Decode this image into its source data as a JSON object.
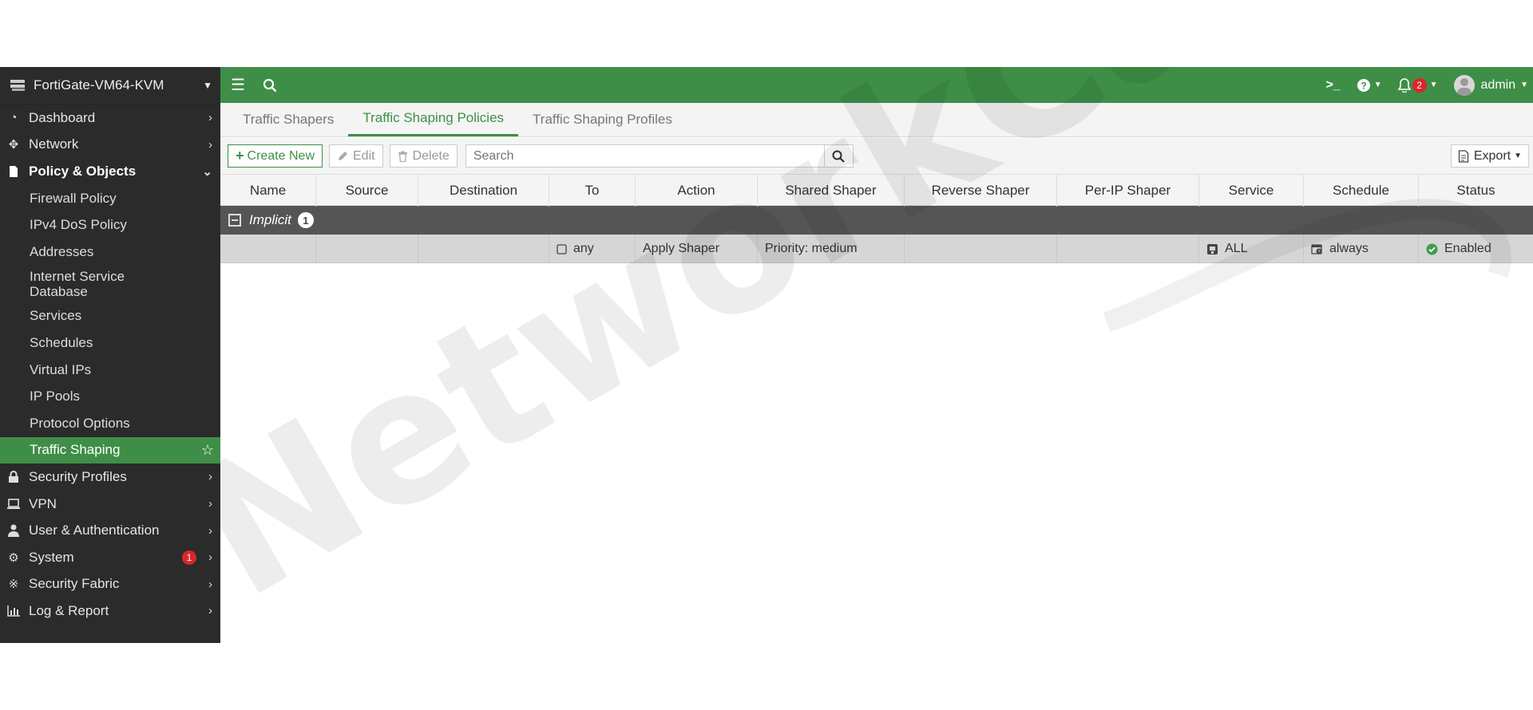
{
  "sidebar": {
    "device": "FortiGate-VM64-KVM",
    "items": [
      {
        "label": "Dashboard"
      },
      {
        "label": "Network"
      },
      {
        "label": "Policy & Objects"
      }
    ],
    "sub_items": [
      {
        "label": "Firewall Policy"
      },
      {
        "label": "IPv4 DoS Policy"
      },
      {
        "label": "Addresses"
      },
      {
        "label": "Internet Service Database"
      },
      {
        "label": "Services"
      },
      {
        "label": "Schedules"
      },
      {
        "label": "Virtual IPs"
      },
      {
        "label": "IP Pools"
      },
      {
        "label": "Protocol Options"
      },
      {
        "label": "Traffic Shaping"
      }
    ],
    "bottom_items": [
      {
        "label": "Security Profiles"
      },
      {
        "label": "VPN"
      },
      {
        "label": "User & Authentication"
      },
      {
        "label": "System",
        "badge": "1"
      },
      {
        "label": "Security Fabric"
      },
      {
        "label": "Log & Report"
      }
    ]
  },
  "topbar": {
    "notifications": "2",
    "user": "admin"
  },
  "tabs": [
    {
      "label": "Traffic Shapers"
    },
    {
      "label": "Traffic Shaping Policies"
    },
    {
      "label": "Traffic Shaping Profiles"
    }
  ],
  "toolbar": {
    "create_new": "Create New",
    "edit": "Edit",
    "delete": "Delete",
    "search_placeholder": "Search",
    "export": "Export"
  },
  "table": {
    "columns": [
      "Name",
      "Source",
      "Destination",
      "To",
      "Action",
      "Shared Shaper",
      "Reverse Shaper",
      "Per-IP Shaper",
      "Service",
      "Schedule",
      "Status"
    ],
    "group": {
      "label": "Implicit",
      "count": "1"
    },
    "row": {
      "name": "",
      "source": "",
      "destination": "",
      "to": "any",
      "action": "Apply Shaper",
      "shared_shaper": "Priority: medium",
      "reverse_shaper": "",
      "per_ip_shaper": "",
      "service": "ALL",
      "schedule": "always",
      "status": "Enabled"
    }
  },
  "watermark": "NetworkCat",
  "colors": {
    "brand_green": "#3f8e48",
    "sidebar_bg": "#2b2b2b",
    "badge_red": "#d9262c"
  }
}
